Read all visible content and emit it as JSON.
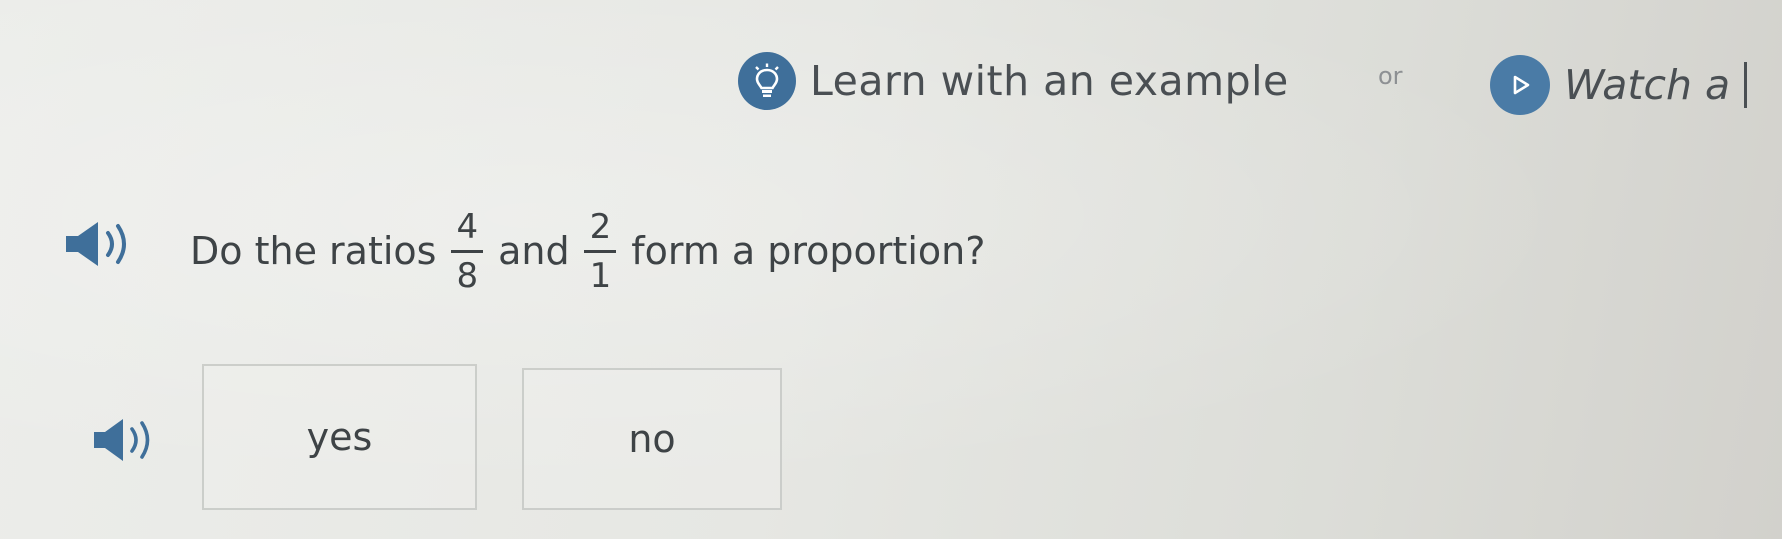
{
  "help_bar": {
    "learn_label": "Learn with an example",
    "learn_icon": "lightbulb-icon",
    "or_text": "or",
    "watch_label": "Watch a",
    "watch_icon": "play-icon",
    "accent_color": "#3f6f9a"
  },
  "question": {
    "prefix": "Do the ratios",
    "fraction_1": {
      "numerator": "4",
      "denominator": "8"
    },
    "middle": "and",
    "fraction_2": {
      "numerator": "2",
      "denominator": "1"
    },
    "suffix": "form a proportion?",
    "audio_icon": "speaker-icon"
  },
  "answers": {
    "audio_icon": "speaker-icon",
    "options": [
      {
        "label": "yes"
      },
      {
        "label": "no"
      }
    ]
  }
}
